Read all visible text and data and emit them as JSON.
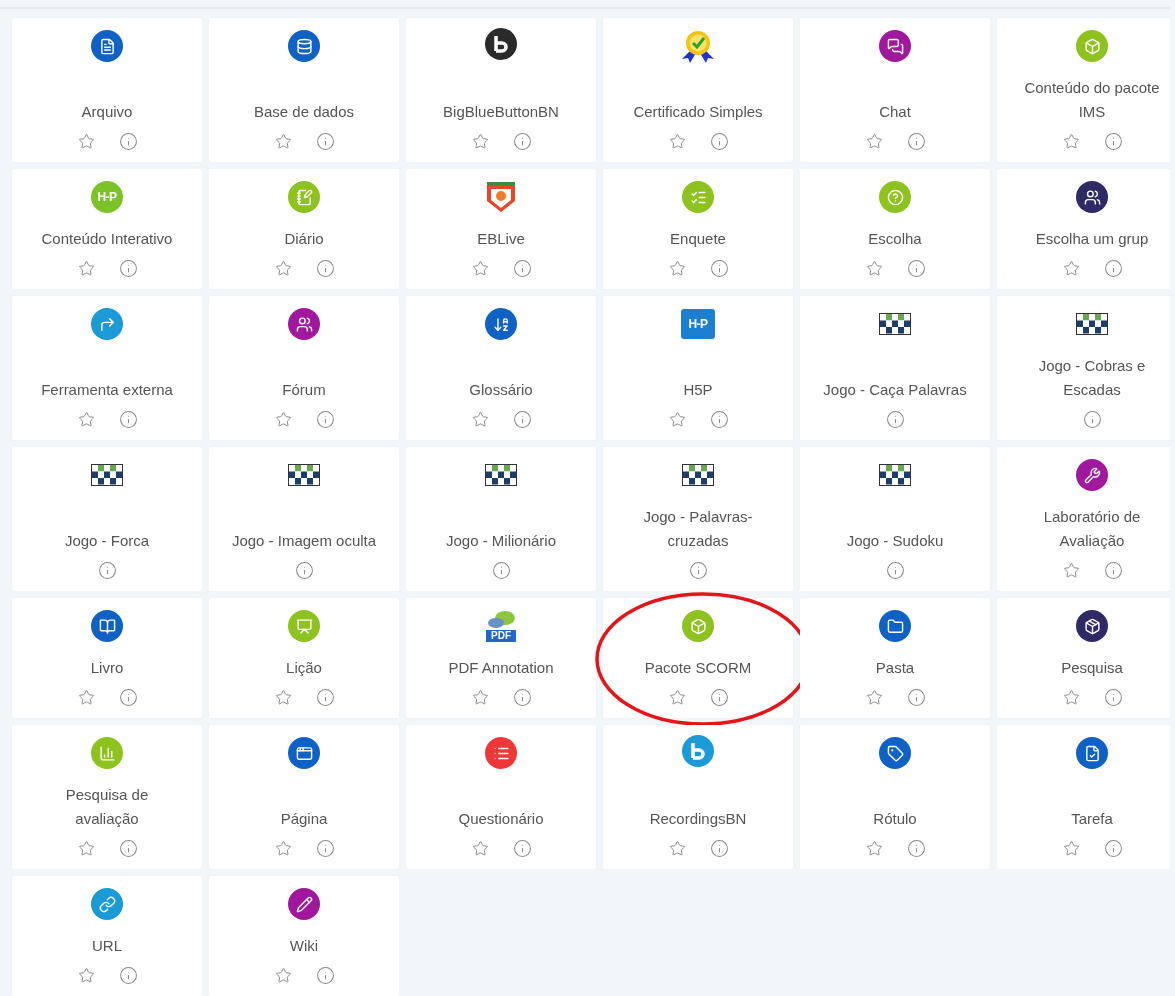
{
  "activities": [
    {
      "label": "Arquivo",
      "kind": "circle",
      "color": "#0f62c4",
      "has_star": true,
      "highlighted": false
    },
    {
      "label": "Base de dados",
      "kind": "circle",
      "color": "#0f62c4",
      "has_star": true,
      "highlighted": false
    },
    {
      "label": "BigBlueButtonBN",
      "kind": "logo",
      "color": "#2b2b2b",
      "has_star": true,
      "highlighted": false
    },
    {
      "label": "Certificado Simples",
      "kind": "certificate",
      "has_star": true,
      "highlighted": false
    },
    {
      "label": "Chat",
      "kind": "circle",
      "color": "#a0189e",
      "has_star": true,
      "highlighted": false
    },
    {
      "label": "Conteúdo do pacote IMS",
      "kind": "circle",
      "color": "#8dc21f",
      "has_star": true,
      "highlighted": false
    },
    {
      "label": "Conteúdo Interativo",
      "kind": "circle",
      "color": "#7cc229",
      "icon_text": "H-P",
      "has_star": true,
      "highlighted": false
    },
    {
      "label": "Diário",
      "kind": "circle",
      "color": "#8dc21f",
      "has_star": true,
      "highlighted": false
    },
    {
      "label": "EBLive",
      "kind": "shield",
      "has_star": true,
      "highlighted": false
    },
    {
      "label": "Enquete",
      "kind": "circle",
      "color": "#8dc21f",
      "has_star": true,
      "highlighted": false
    },
    {
      "label": "Escolha",
      "kind": "circle",
      "color": "#8dc21f",
      "has_star": true,
      "highlighted": false
    },
    {
      "label": "Escolha um grup",
      "kind": "circle",
      "color": "#2e2a66",
      "has_star": true,
      "highlighted": false
    },
    {
      "label": "Ferramenta externa",
      "kind": "circle",
      "color": "#1a9ad6",
      "has_star": true,
      "highlighted": false
    },
    {
      "label": "Fórum",
      "kind": "circle",
      "color": "#a0189e",
      "has_star": true,
      "highlighted": false
    },
    {
      "label": "Glossário",
      "kind": "circle",
      "color": "#0f62c4",
      "has_star": true,
      "highlighted": false
    },
    {
      "label": "H5P",
      "kind": "square",
      "color": "#1d7fd1",
      "icon_text": "H-P",
      "has_star": true,
      "highlighted": false
    },
    {
      "label": "Jogo - Caça Palavras",
      "kind": "board",
      "has_star": false,
      "highlighted": false
    },
    {
      "label": "Jogo - Cobras e Escadas",
      "kind": "board",
      "has_star": false,
      "highlighted": false
    },
    {
      "label": "Jogo - Forca",
      "kind": "board",
      "has_star": false,
      "highlighted": false
    },
    {
      "label": "Jogo - Imagem oculta",
      "kind": "board",
      "has_star": false,
      "highlighted": false
    },
    {
      "label": "Jogo - Milionário",
      "kind": "board",
      "has_star": false,
      "highlighted": false
    },
    {
      "label": "Jogo - Palavras-cruzadas",
      "kind": "board",
      "has_star": false,
      "highlighted": false
    },
    {
      "label": "Jogo - Sudoku",
      "kind": "board",
      "has_star": false,
      "highlighted": false
    },
    {
      "label": "Laboratório de Avaliação",
      "kind": "circle",
      "color": "#a0189e",
      "has_star": true,
      "highlighted": false
    },
    {
      "label": "Livro",
      "kind": "circle",
      "color": "#0f62c4",
      "has_star": true,
      "highlighted": false
    },
    {
      "label": "Lição",
      "kind": "circle",
      "color": "#8dc21f",
      "has_star": true,
      "highlighted": false
    },
    {
      "label": "PDF Annotation",
      "kind": "pdf",
      "icon_text": "PDF",
      "has_star": true,
      "highlighted": false
    },
    {
      "label": "Pacote SCORM",
      "kind": "circle",
      "color": "#8dc21f",
      "has_star": true,
      "highlighted": true
    },
    {
      "label": "Pasta",
      "kind": "circle",
      "color": "#0f62c4",
      "has_star": true,
      "highlighted": false
    },
    {
      "label": "Pesquisa",
      "kind": "circle",
      "color": "#2e2a66",
      "has_star": true,
      "highlighted": false
    },
    {
      "label": "Pesquisa de avaliação",
      "kind": "circle",
      "color": "#8dc21f",
      "has_star": true,
      "highlighted": false
    },
    {
      "label": "Página",
      "kind": "circle",
      "color": "#0f62c4",
      "has_star": true,
      "highlighted": false
    },
    {
      "label": "Questionário",
      "kind": "circle",
      "color": "#ef3737",
      "has_star": true,
      "highlighted": false
    },
    {
      "label": "RecordingsBN",
      "kind": "logo",
      "color": "#1a9ad6",
      "has_star": true,
      "highlighted": false
    },
    {
      "label": "Rótulo",
      "kind": "circle",
      "color": "#0f62c4",
      "has_star": true,
      "highlighted": false
    },
    {
      "label": "Tarefa",
      "kind": "circle",
      "color": "#0f62c4",
      "has_star": true,
      "highlighted": false
    },
    {
      "label": "URL",
      "kind": "circle",
      "color": "#1a9ad6",
      "has_star": true,
      "highlighted": false
    },
    {
      "label": "Wiki",
      "kind": "circle",
      "color": "#a0189e",
      "has_star": true,
      "highlighted": false
    }
  ]
}
